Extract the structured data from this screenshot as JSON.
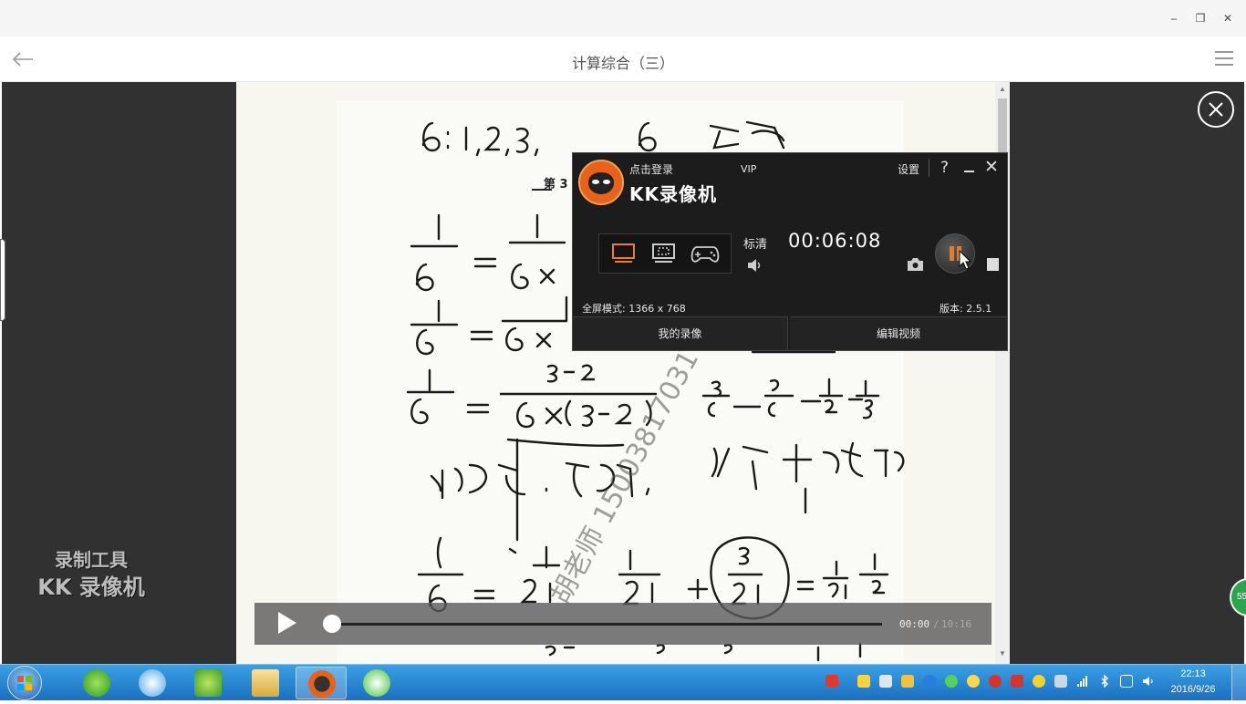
{
  "window": {
    "minimize_label": "–",
    "maximize_label": "❐",
    "close_label": "✕"
  },
  "nav": {
    "back_icon": "back-arrow-icon",
    "title": "计算综合（三）",
    "menu_icon": "hamburger-menu-icon"
  },
  "document": {
    "scan_text_note": "",
    "stamp_text": "胡老师 15003817031"
  },
  "watermark": {
    "line1": "录制工具",
    "line2": "KK 录像机"
  },
  "video": {
    "current_time": "00:00",
    "separator": "/",
    "total_time": "10:16",
    "progress_fraction": 0.0
  },
  "recorder": {
    "login": "点击登录",
    "vip": "VIP",
    "brand": "KK录像机",
    "settings": "设置",
    "help": "?",
    "close": "✕",
    "quality": "标清",
    "timer": "00:06:08",
    "mode_text": "全屏模式: 1366 x 768",
    "version": "版本: 2.5.1",
    "my_recordings": "我的录像",
    "edit_video": "编辑视频",
    "accent_color": "#e8621a"
  },
  "taskbar": {
    "clock_time": "22:13",
    "clock_date": "2016/9/26",
    "badge": "55"
  },
  "colors": {
    "taskbar": "#2d8ad8",
    "viewer_bg": "#313131",
    "accent": "#e8621a"
  }
}
